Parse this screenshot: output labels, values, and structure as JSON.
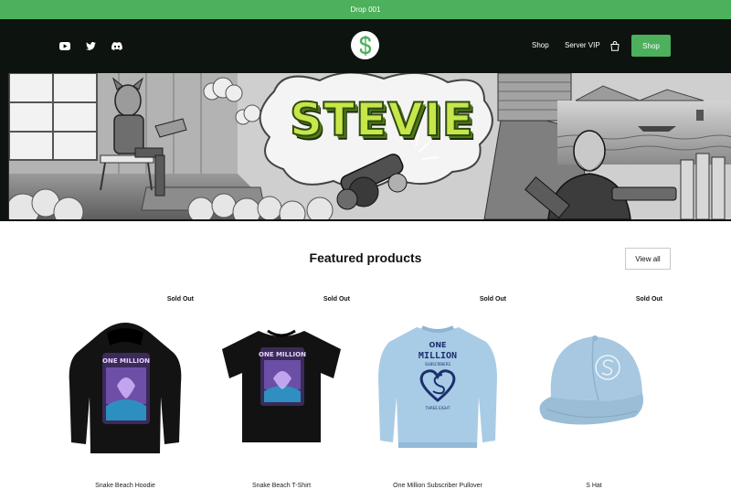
{
  "announcement": {
    "text": "Drop 001"
  },
  "header": {
    "social_icons": [
      "youtube-icon",
      "twitter-icon",
      "discord-icon"
    ],
    "nav": {
      "shop": "Shop",
      "server_vip": "Server VIP"
    },
    "cta": "Shop",
    "accent_color": "#4cb05c",
    "bg_color": "#0d130f"
  },
  "hero": {
    "title": "STEVIE"
  },
  "featured": {
    "title": "Featured products",
    "view_all": "View all",
    "products": [
      {
        "badge": "Sold Out",
        "name": "Snake Beach Hoodie",
        "graphic_top": "ONE MILLION"
      },
      {
        "badge": "Sold Out",
        "name": "Snake Beach T-Shirt",
        "graphic_top": "ONE MILLION"
      },
      {
        "badge": "Sold Out",
        "name": "One Million Subscriber Pullover",
        "graphic_top": "ONE",
        "graphic_mid": "MILLION",
        "graphic_sub": "SUBSCRIBERS",
        "graphic_foot": "THREE EIGHT"
      },
      {
        "badge": "Sold Out",
        "name": "S Hat"
      }
    ]
  }
}
